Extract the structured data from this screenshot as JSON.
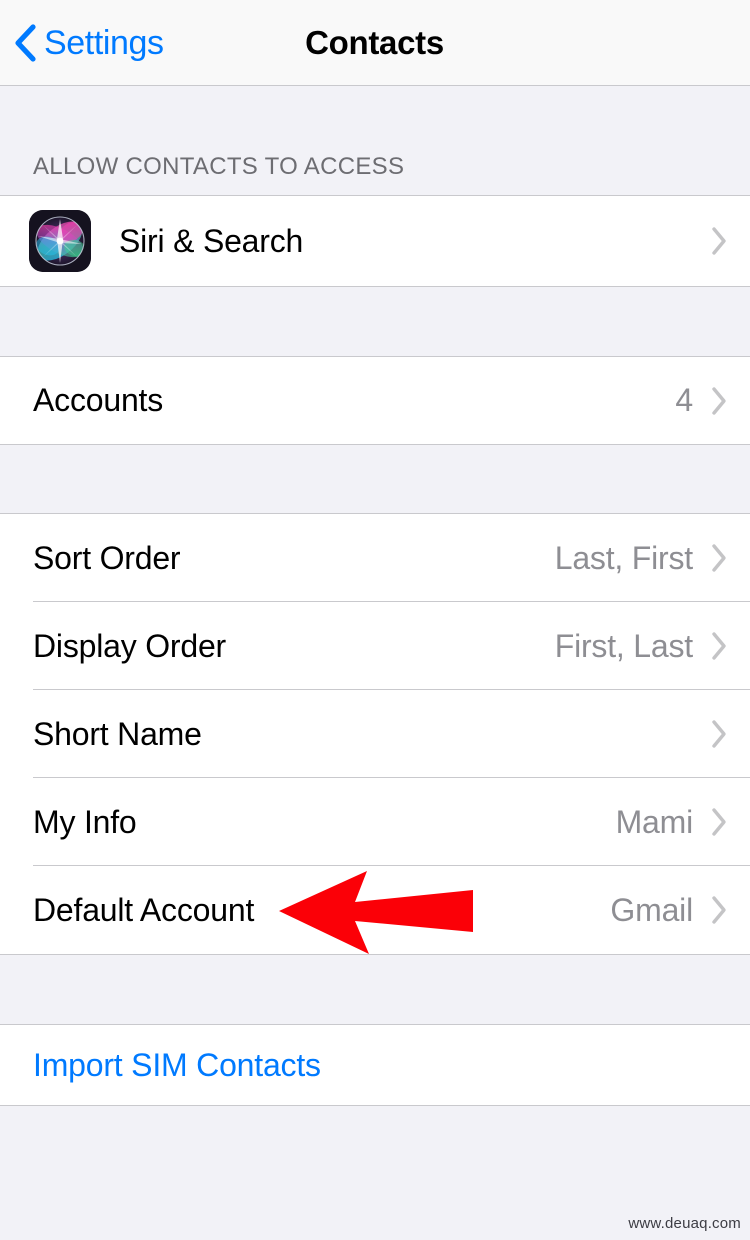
{
  "navbar": {
    "back_label": "Settings",
    "back_icon": "chevron-left-icon",
    "title": "Contacts"
  },
  "sections": [
    {
      "header": "ALLOW CONTACTS TO ACCESS",
      "rows": [
        {
          "label": "Siri & Search",
          "value": "",
          "icon": "siri-app-icon",
          "chevron": true
        }
      ]
    },
    {
      "header": "",
      "rows": [
        {
          "label": "Accounts",
          "value": "4",
          "chevron": true
        }
      ]
    },
    {
      "header": "",
      "rows": [
        {
          "label": "Sort Order",
          "value": "Last, First",
          "chevron": true
        },
        {
          "label": "Display Order",
          "value": "First, Last",
          "chevron": true
        },
        {
          "label": "Short Name",
          "value": "",
          "chevron": true
        },
        {
          "label": "My Info",
          "value": "Mami",
          "chevron": true
        },
        {
          "label": "Default Account",
          "value": "Gmail",
          "chevron": true
        }
      ]
    },
    {
      "header": "",
      "rows": [
        {
          "label": "Import SIM Contacts",
          "value": "",
          "chevron": false,
          "style": "link"
        }
      ]
    }
  ],
  "annotation": {
    "type": "arrow-left",
    "color": "#fb0007",
    "points_at": "Default Account"
  },
  "watermark": "www.deuaq.com",
  "colors": {
    "accent_blue": "#007aff",
    "value_gray": "#8e8e93",
    "group_background": "#f2f2f7",
    "row_background": "#ffffff",
    "separator": "#c9c9cd",
    "annotation_red": "#fb0007"
  }
}
